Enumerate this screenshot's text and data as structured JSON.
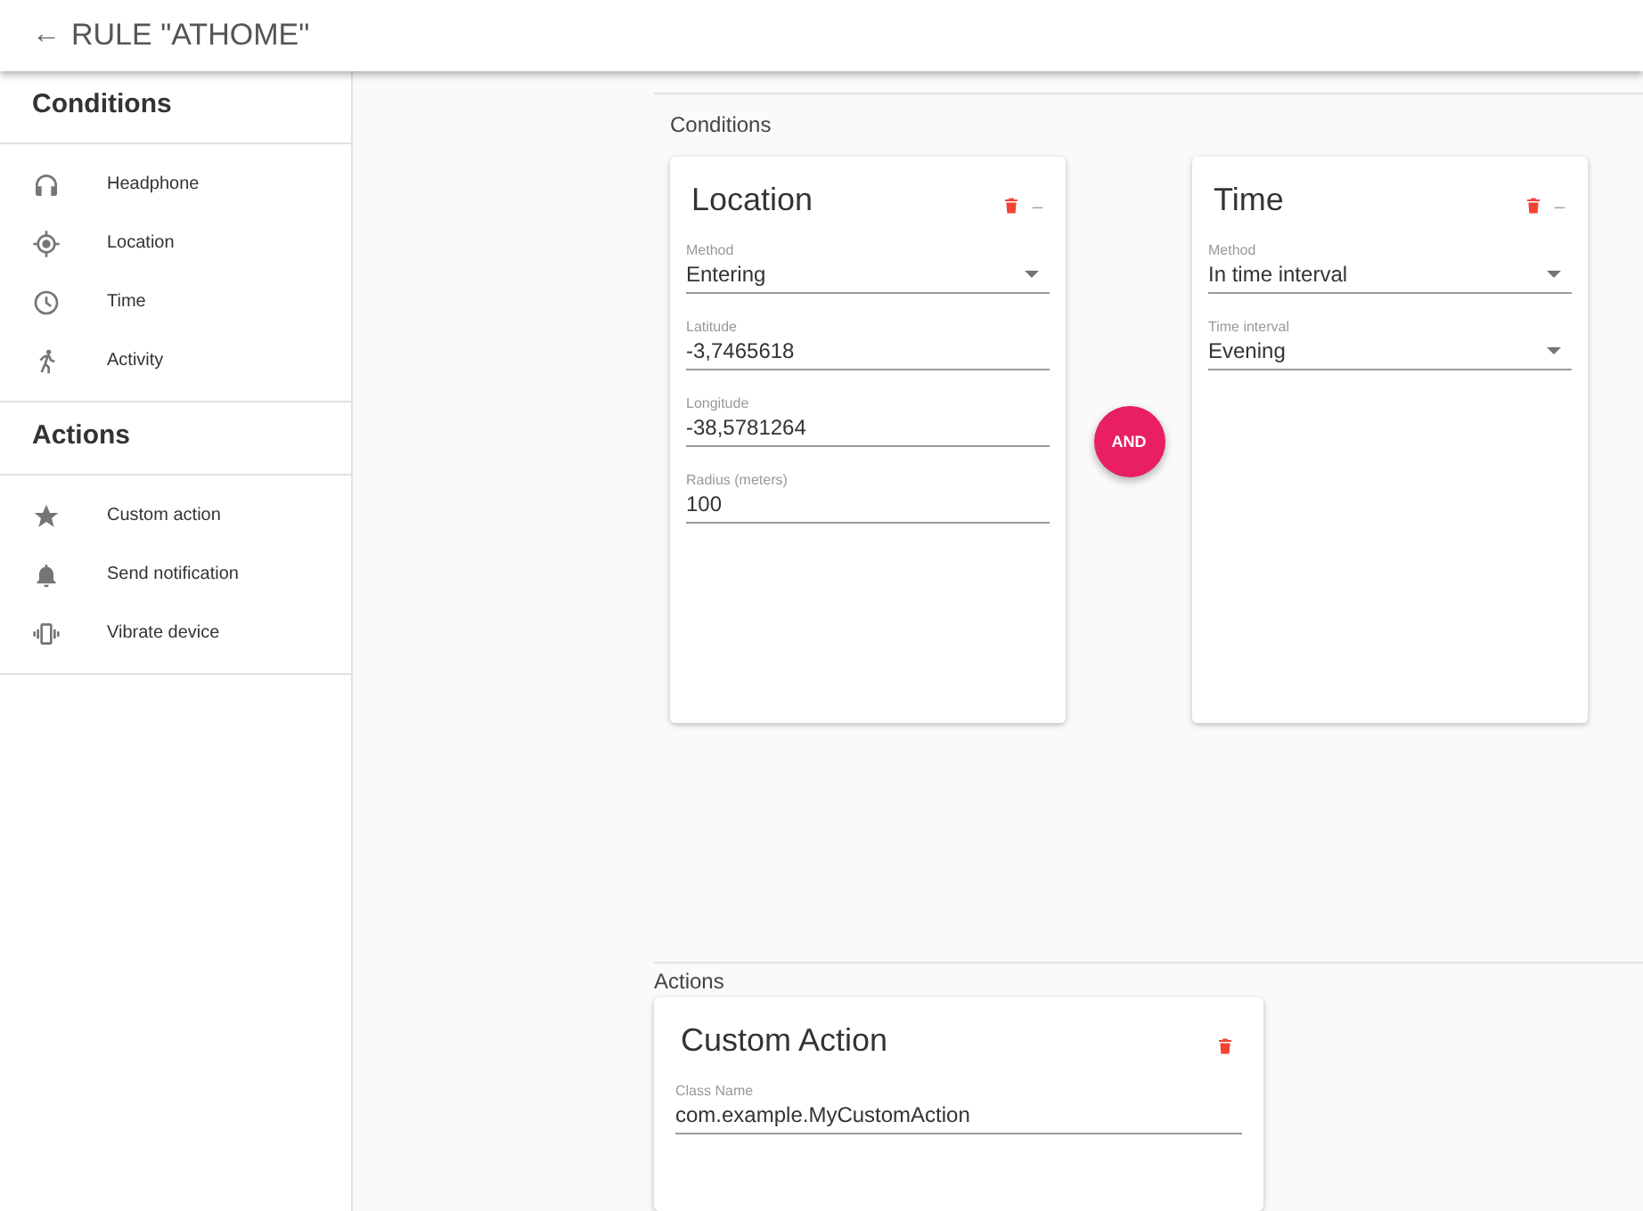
{
  "header": {
    "back": "←",
    "title": "RULE \"ATHOME\""
  },
  "sidebar": {
    "sections": [
      {
        "title": "Conditions",
        "items": [
          {
            "label": "Headphone"
          },
          {
            "label": "Location"
          },
          {
            "label": "Time"
          },
          {
            "label": "Activity"
          }
        ]
      },
      {
        "title": "Actions",
        "items": [
          {
            "label": "Custom action"
          },
          {
            "label": "Send notification"
          },
          {
            "label": "Vibrate device"
          }
        ]
      }
    ]
  },
  "conditions": {
    "title": "Conditions",
    "operator": "AND",
    "cards": [
      {
        "title": "Location",
        "minimize": "_",
        "fields": [
          {
            "kind": "select",
            "label": "Method",
            "value": "Entering"
          },
          {
            "kind": "text",
            "label": "Latitude",
            "value": "-3,7465618"
          },
          {
            "kind": "text",
            "label": "Longitude",
            "value": "-38,5781264"
          },
          {
            "kind": "text",
            "label": "Radius (meters)",
            "value": "100"
          }
        ]
      },
      {
        "title": "Time",
        "minimize": "_",
        "fields": [
          {
            "kind": "select",
            "label": "Method",
            "value": "In time interval"
          },
          {
            "kind": "select",
            "label": "Time interval",
            "value": "Evening"
          }
        ]
      }
    ]
  },
  "actions": {
    "title": "Actions",
    "cards": [
      {
        "title": "Custom Action",
        "fields": [
          {
            "label": "Class Name",
            "value": "com.example.MyCustomAction"
          }
        ]
      }
    ]
  }
}
